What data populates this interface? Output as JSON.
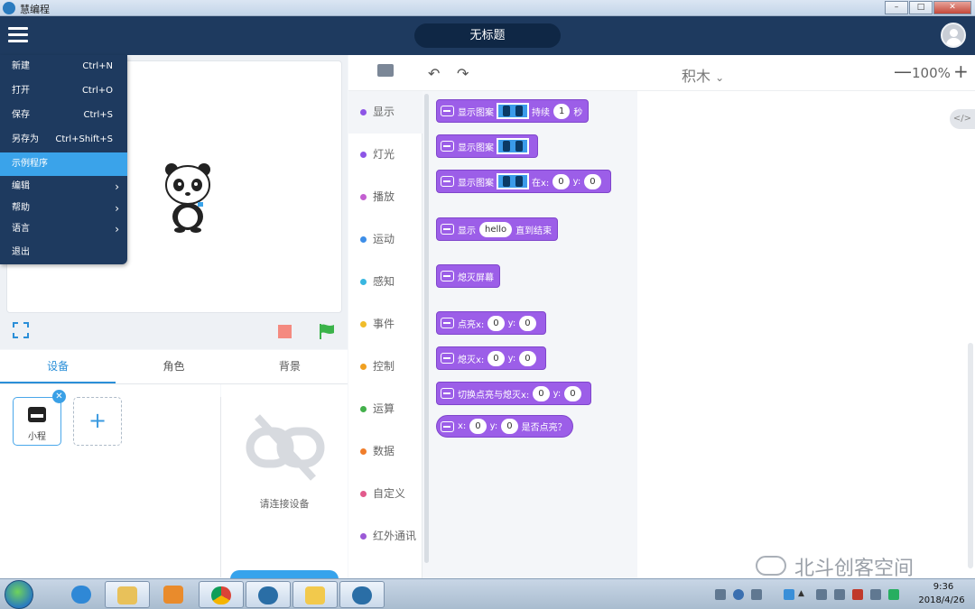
{
  "window": {
    "title": "慧编程",
    "buttons": [
      "–",
      "□",
      "✕"
    ]
  },
  "header": {
    "project_title": "无标题"
  },
  "file_menu": [
    {
      "label": "新建",
      "shortcut": "Ctrl+N"
    },
    {
      "label": "打开",
      "shortcut": "Ctrl+O"
    },
    {
      "label": "保存",
      "shortcut": "Ctrl+S"
    },
    {
      "label": "另存为",
      "shortcut": "Ctrl+Shift+S"
    },
    {
      "label": "示例程序",
      "shortcut": "",
      "highlighted": true
    },
    {
      "label": "编辑",
      "submenu": true
    },
    {
      "label": "帮助",
      "submenu": true
    },
    {
      "label": "语言",
      "submenu": true
    },
    {
      "label": "退出"
    }
  ],
  "tabs": [
    {
      "label": "设备",
      "active": true
    },
    {
      "label": "角色"
    },
    {
      "label": "背景"
    }
  ],
  "device": {
    "name": "小程",
    "add": "+"
  },
  "connect": {
    "message": "请连接设备"
  },
  "categories": [
    {
      "label": "显示",
      "color": "#8d55e6"
    },
    {
      "label": "灯光",
      "color": "#8d55e6"
    },
    {
      "label": "播放",
      "color": "#c35fd1"
    },
    {
      "label": "运动",
      "color": "#3d8ee8"
    },
    {
      "label": "感知",
      "color": "#38b6e0"
    },
    {
      "label": "事件",
      "color": "#f0bc2a"
    },
    {
      "label": "控制",
      "color": "#f0a020"
    },
    {
      "label": "运算",
      "color": "#43b04b"
    },
    {
      "label": "数据",
      "color": "#f07d2a"
    },
    {
      "label": "自定义",
      "color": "#e25a8c"
    },
    {
      "label": "红外通讯",
      "color": "#9b59d6"
    }
  ],
  "blocks": {
    "b1": {
      "text": "显示图案",
      "mid": "持续",
      "value": "1",
      "end": "秒"
    },
    "b2": {
      "text": "显示图案"
    },
    "b3": {
      "text": "显示图案",
      "mid": "在x:",
      "x": "0",
      "ylabel": "y:",
      "y": "0"
    },
    "b4": {
      "text": "显示",
      "value": "hello",
      "end": "直到结束"
    },
    "b5": {
      "text": "熄灭屏幕"
    },
    "b6": {
      "text": "点亮x:",
      "x": "0",
      "ylabel": "y:",
      "y": "0"
    },
    "b7": {
      "text": "熄灭x:",
      "x": "0",
      "ylabel": "y:",
      "y": "0"
    },
    "b8": {
      "text": "切换点亮与熄灭x:",
      "x": "0",
      "ylabel": "y:",
      "y": "0"
    },
    "b9": {
      "text": "x:",
      "x": "0",
      "ylabel": "y:",
      "y": "0",
      "end": "是否点亮？"
    }
  },
  "workspace": {
    "mode": "积木",
    "mode_arrow": "⌄",
    "zoom": "100%",
    "zoom_out": "—",
    "zoom_in": "+",
    "code_toggle": "</>"
  },
  "watermark": {
    "text": "北斗创客空间"
  },
  "clock": {
    "time": "9:36",
    "date": "2018/4/26"
  },
  "colors": {
    "header": "#1e3a5f",
    "accent": "#36a3ec",
    "block": "#9c5ee8"
  }
}
